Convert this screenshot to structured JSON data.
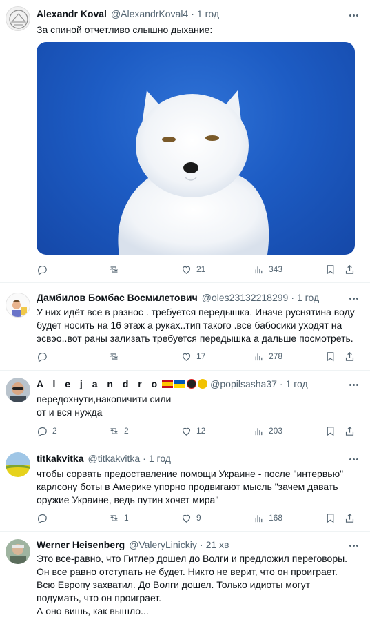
{
  "tweets": [
    {
      "name": "Alexandr Koval",
      "handle": "@AlexandrKoval4",
      "time": "1 год",
      "text": "За спиной отчетливо слышно дыхание:",
      "replies": "",
      "retweets": "",
      "likes": "21",
      "views": "343"
    },
    {
      "name": "Дамбилов Бомбас Восмилетович",
      "handle": "@oles23132218299",
      "time": "1 год",
      "text": "У них идёт все в разнос . требуется передышка. Иначе руснятина воду будет носить на 16 этаж а руках..тип такого .все бабосики уходят на эсвэо..вот раны зализать требуется передышка а дальше посмотреть.",
      "replies": "",
      "retweets": "",
      "likes": "17",
      "views": "278"
    },
    {
      "name": "A l e j a n d r o",
      "handle": "@popilsasha37",
      "time": "1 год",
      "text": "передохнути,накопичити сили\nот и вся нужда",
      "replies": "2",
      "retweets": "2",
      "likes": "12",
      "views": "203"
    },
    {
      "name": "titkakvitka",
      "handle": "@titkakvitka",
      "time": "1 год",
      "text": "чтобы сорвать предоставление помощи Украине - после \"интервью\" карлсону боты в Америке упорно продвигают мысль \"зачем давать оружие Украине, ведь путин хочет мира\"",
      "replies": "",
      "retweets": "1",
      "likes": "9",
      "views": "168"
    },
    {
      "name": "Werner Heisenberg",
      "handle": "@ValeryLinickiy",
      "time": "21 хв",
      "text": "Это все-равно, что Гитлер дошел до Волги и предложил переговоры. Он все равно отступать не будет. Никто не верит, что он проиграет. Всю Европу захватил. До Волги дошел. Только идиоты могут подумать, что он проиграет.\nА оно вишь, как вышло..."
    }
  ],
  "colors": {
    "muted": "#536471",
    "text": "#0f1419",
    "divider": "#eff3f4"
  },
  "icons": [
    "reply-icon",
    "retweet-icon",
    "like-icon",
    "views-icon",
    "bookmark-icon",
    "share-icon",
    "more-icon"
  ]
}
